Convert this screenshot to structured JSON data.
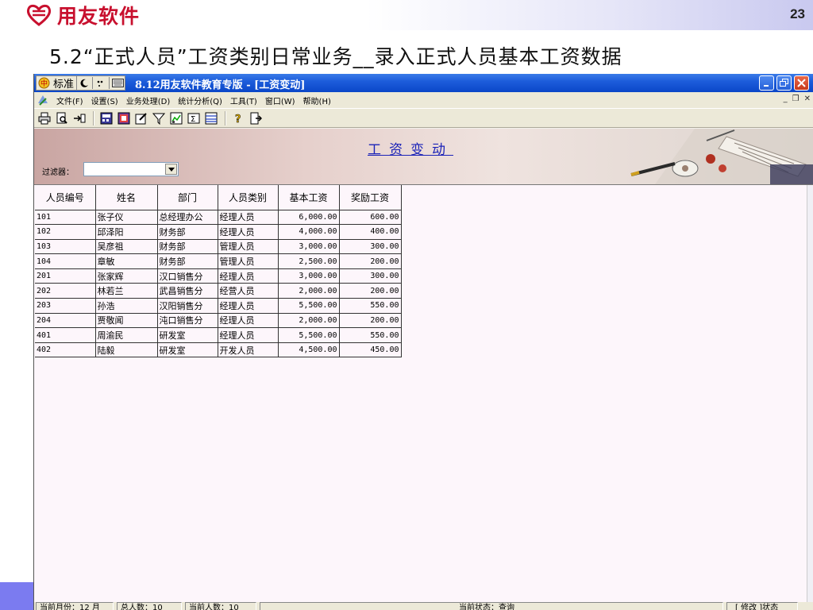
{
  "slide": {
    "brand": "用友软件",
    "page_number": "23",
    "title": "5.2“正式人员”工资类别日常业务__录入正式人员基本工资数据"
  },
  "window": {
    "std_toolbar_label": "标准",
    "title": "8.12用友软件教育专版 - [工资变动]"
  },
  "menu": [
    "文件(F)",
    "设置(S)",
    "业务处理(D)",
    "统计分析(Q)",
    "工具(T)",
    "窗口(W)",
    "帮助(H)"
  ],
  "toolbar_icons": [
    "print-icon",
    "print-preview-icon",
    "output-icon",
    "calculator-icon",
    "summary-icon",
    "edit-icon",
    "filter-icon",
    "set-icon",
    "replace-icon",
    "grid-icon",
    "help-icon",
    "exit-icon"
  ],
  "banner": {
    "title": "工资变动",
    "filter_label": "过滤器：",
    "filter_value": ""
  },
  "grid": {
    "headers": [
      "人员编号",
      "姓名",
      "部门",
      "人员类别",
      "基本工资",
      "奖励工资"
    ],
    "rows": [
      [
        "101",
        "张子仪",
        "总经理办公",
        "经理人员",
        "6,000.00",
        "600.00"
      ],
      [
        "102",
        "邱泽阳",
        "财务部",
        "经理人员",
        "4,000.00",
        "400.00"
      ],
      [
        "103",
        "吴彦祖",
        "财务部",
        "管理人员",
        "3,000.00",
        "300.00"
      ],
      [
        "104",
        "章敏",
        "财务部",
        "管理人员",
        "2,500.00",
        "200.00"
      ],
      [
        "201",
        "张家辉",
        "汉口销售分",
        "经理人员",
        "3,000.00",
        "300.00"
      ],
      [
        "202",
        "林若兰",
        "武昌销售分",
        "经营人员",
        "2,000.00",
        "200.00"
      ],
      [
        "203",
        "孙浩",
        "汉阳销售分",
        "经理人员",
        "5,500.00",
        "550.00"
      ],
      [
        "204",
        "贾敬闻",
        "沌口销售分",
        "经理人员",
        "2,000.00",
        "200.00"
      ],
      [
        "401",
        "周渝民",
        "研发室",
        "经理人员",
        "5,500.00",
        "550.00"
      ],
      [
        "402",
        "陆毅",
        "研发室",
        "开发人员",
        "4,500.00",
        "450.00"
      ]
    ]
  },
  "status": {
    "month": "当前月份：12 月",
    "total": "总人数：10",
    "current": "当前人数：10",
    "state": "当前状态：查询",
    "mode": "[ 修改 ]状态"
  },
  "colors": {
    "brand_red": "#c8102e",
    "titlebar_blue": "#0a46c8",
    "banner_title_blue": "#1b23b8",
    "accent_purple": "#7b7bf0"
  }
}
